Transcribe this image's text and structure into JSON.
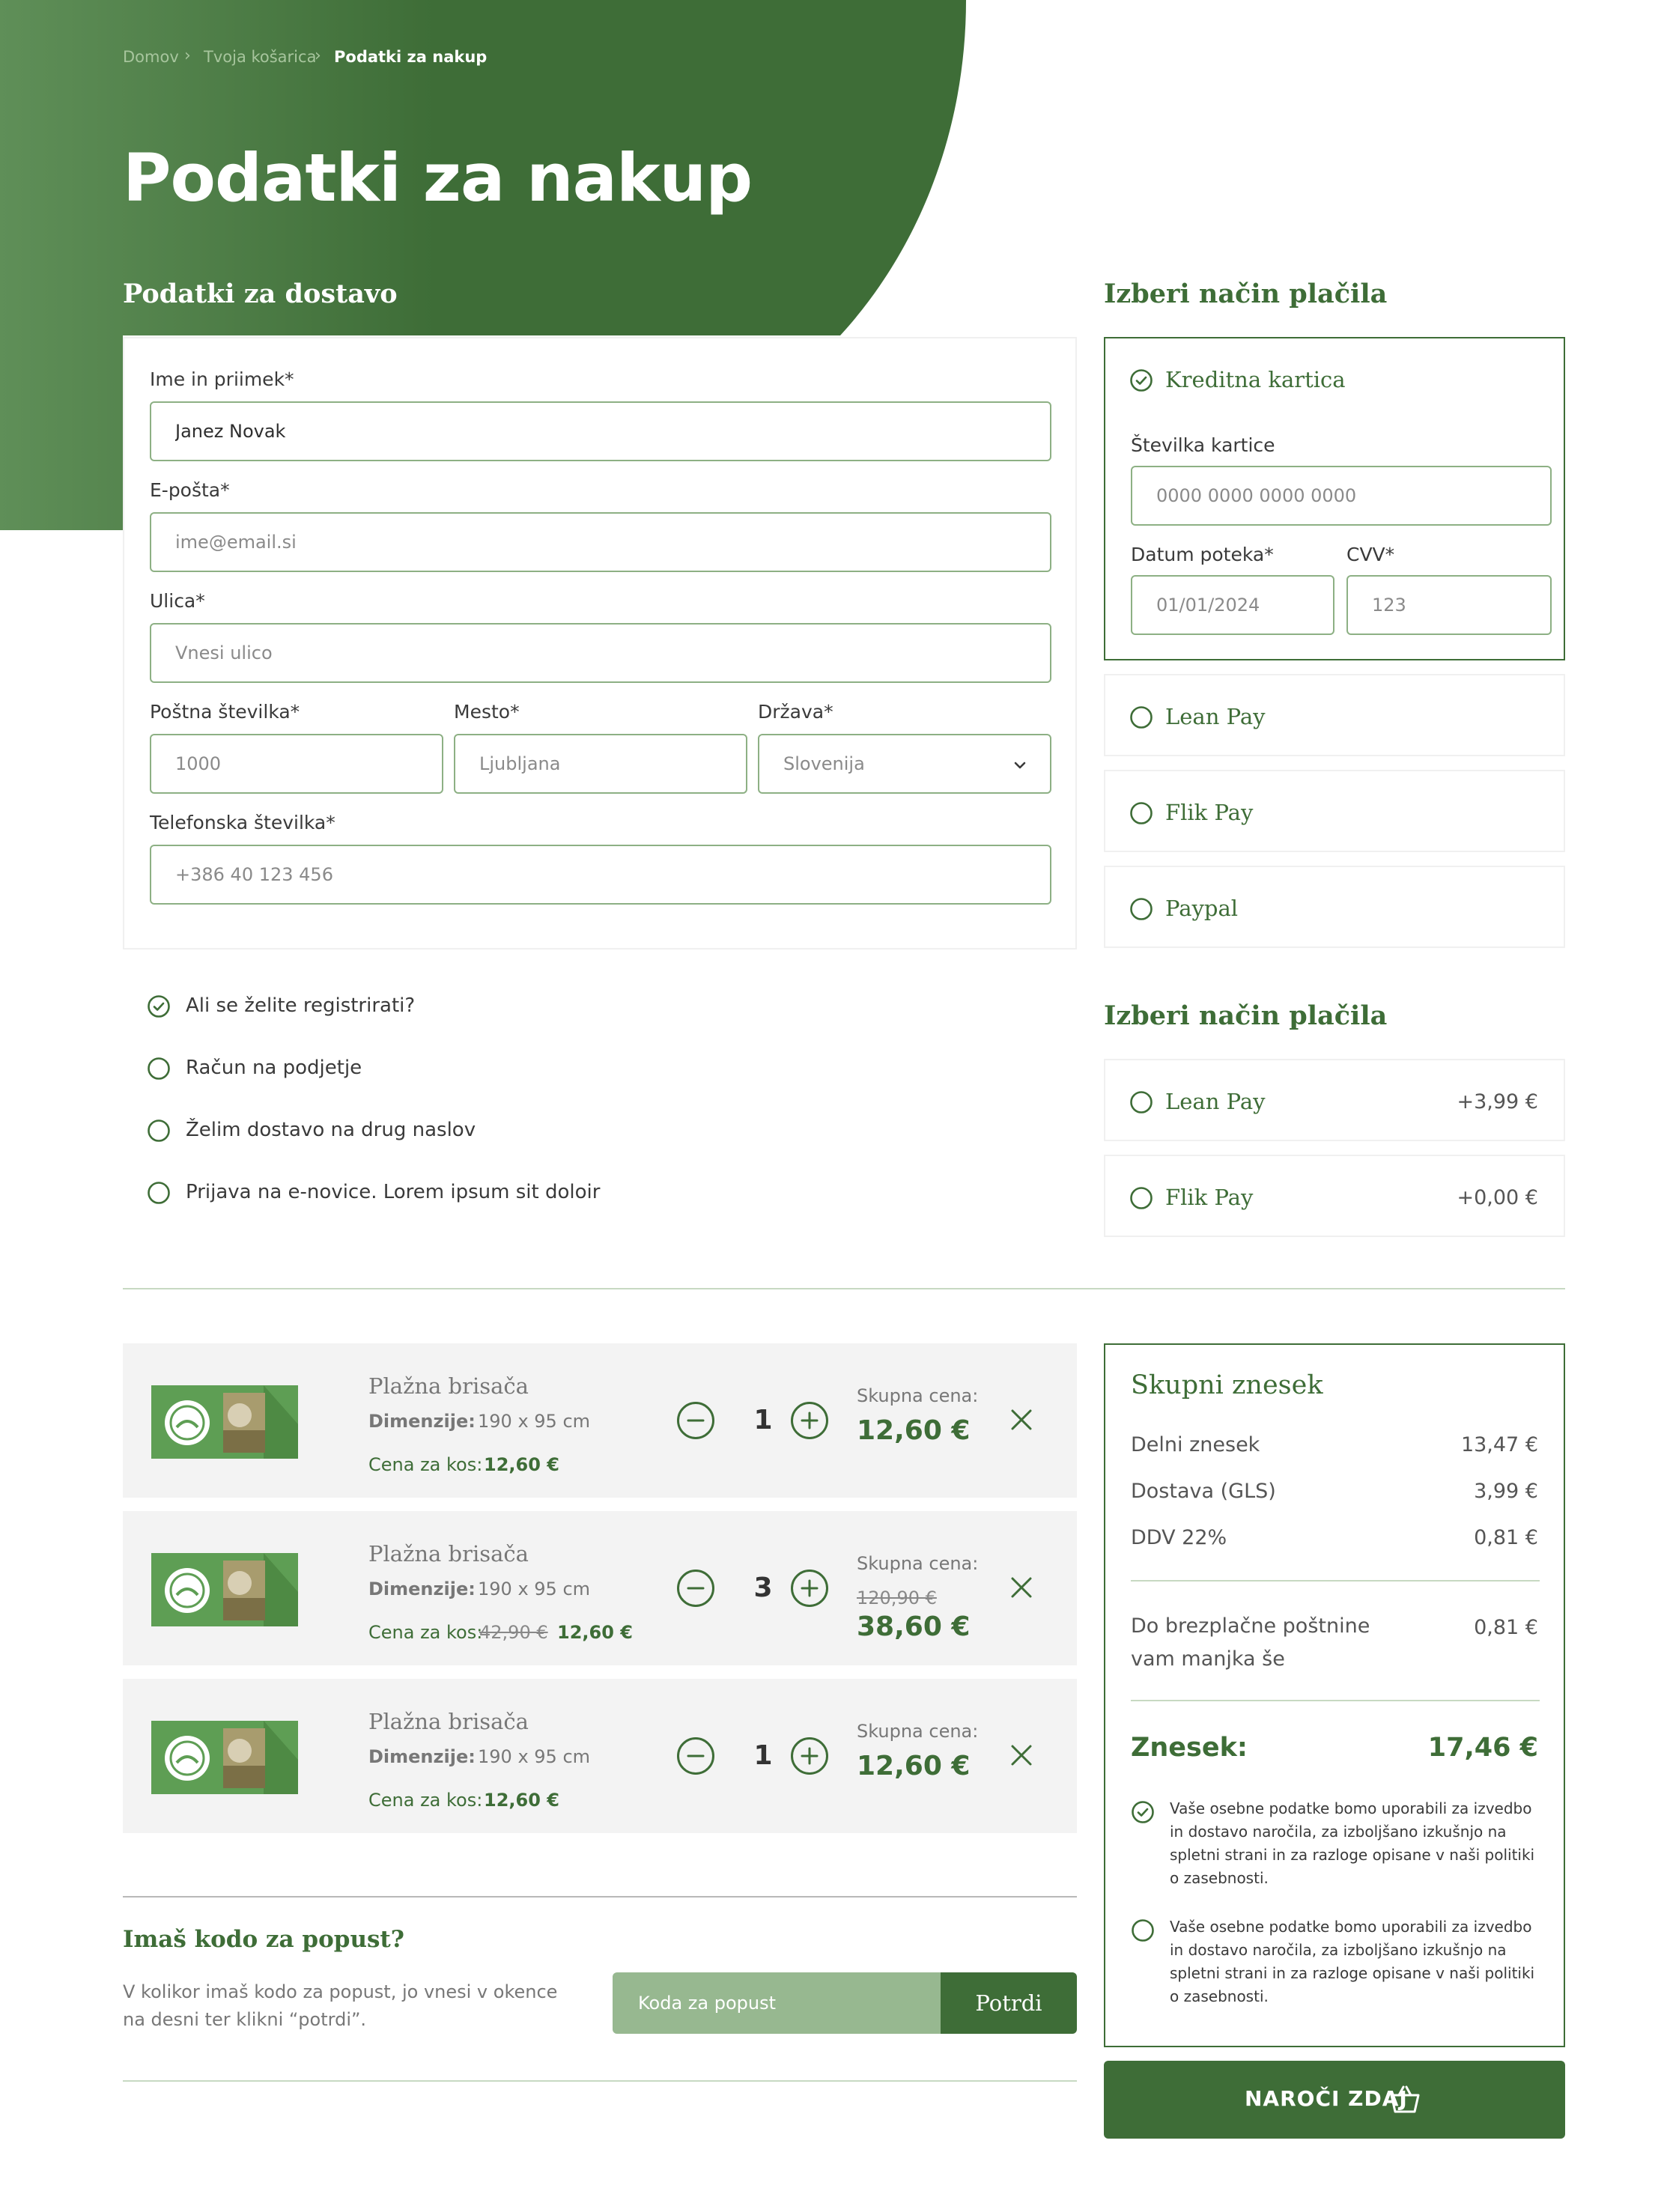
{
  "breadcrumb": {
    "home": "Domov",
    "cart": "Tvoja košarica",
    "current": "Podatki za nakup"
  },
  "page_title": "Podatki za nakup",
  "shipping": {
    "title": "Podatki za dostavo",
    "name_label": "Ime in priimek*",
    "name_value": "Janez Novak",
    "email_label": "E-pošta*",
    "email_placeholder": "ime@email.si",
    "street_label": "Ulica*",
    "street_placeholder": "Vnesi ulico",
    "zip_label": "Poštna številka*",
    "zip_placeholder": "1000",
    "city_label": "Mesto*",
    "city_placeholder": "Ljubljana",
    "country_label": "Država*",
    "country_value": "Slovenija",
    "phone_label": "Telefonska številka*",
    "phone_placeholder": "+386 40 123 456"
  },
  "options": [
    {
      "label": "Ali se želite registrirati?",
      "checked": true
    },
    {
      "label": "Račun na podjetje",
      "checked": false
    },
    {
      "label": "Želim dostavo na drug naslov",
      "checked": false
    },
    {
      "label": "Prijava na e-novice. Lorem ipsum sit doloir",
      "checked": false
    }
  ],
  "payment": {
    "title": "Izberi način plačila",
    "card_label": "Kreditna kartica",
    "card_number_label": "Številka kartice",
    "card_number_placeholder": "0000 0000 0000 0000",
    "expiry_label": "Datum poteka*",
    "expiry_placeholder": "01/01/2024",
    "cvv_label": "CVV*",
    "cvv_placeholder": "123",
    "methods": [
      "Lean Pay",
      "Flik Pay",
      "Paypal"
    ]
  },
  "delivery": {
    "title": "Izberi način plačila",
    "methods": [
      {
        "name": "Lean Pay",
        "price": "+3,99 €"
      },
      {
        "name": "Flik Pay",
        "price": "+0,00 €"
      }
    ]
  },
  "cart": {
    "items": [
      {
        "name": "Plažna brisača",
        "dim_label": "Dimenzije:",
        "dim_value": "190 x 95 cm",
        "unit_label": "Cena za kos:",
        "unit_old": "",
        "unit_price": "12,60 €",
        "qty": "1",
        "total_label": "Skupna cena:",
        "total_old": "",
        "total": "12,60 €"
      },
      {
        "name": "Plažna brisača",
        "dim_label": "Dimenzije:",
        "dim_value": "190 x 95 cm",
        "unit_label": "Cena za kos:",
        "unit_old": "42,90 €",
        "unit_price": "12,60 €",
        "qty": "3",
        "total_label": "Skupna cena:",
        "total_old": "120,90 €",
        "total": "38,60 €"
      },
      {
        "name": "Plažna brisača",
        "dim_label": "Dimenzije:",
        "dim_value": "190 x 95 cm",
        "unit_label": "Cena za kos:",
        "unit_old": "",
        "unit_price": "12,60 €",
        "qty": "1",
        "total_label": "Skupna cena:",
        "total_old": "",
        "total": "12,60 €"
      }
    ]
  },
  "discount": {
    "title": "Imaš kodo za popust?",
    "description": "V kolikor imaš kodo za popust, jo vnesi v okence na desni ter klikni  “potrdi”.",
    "placeholder": "Koda za popust",
    "button": "Potrdi"
  },
  "summary": {
    "title": "Skupni znesek",
    "subtotal_label": "Delni znesek",
    "subtotal": "13,47 €",
    "shipping_label": "Dostava (GLS)",
    "shipping": "3,99 €",
    "vat_label": "DDV 22%",
    "vat": "0,81 €",
    "free_shipping_line1": "Do brezplačne poštnine",
    "free_shipping_line2": "vam manjka še",
    "free_shipping": "0,81 €",
    "total_label": "Znesek:",
    "total": "17,46 €",
    "consents": [
      {
        "text": "Vaše osebne podatke bomo uporabili za izvedbo in dostavo naročila, za izboljšano izkušnjo na spletni strani in za razloge opisane v naši politiki o zasebnosti.",
        "checked": true
      },
      {
        "text": "Vaše osebne podatke bomo uporabili za izvedbo in dostavo naročila, za izboljšano izkušnjo na spletni strani in za razloge opisane v naši politiki o zasebnosti.",
        "checked": false
      }
    ]
  },
  "order_button": "NAROČI ZDAJ",
  "colors": {
    "primary": "#3e6d37",
    "hero_light": "#5f8f58",
    "field_border": "#8db084",
    "discount_input": "#97b890",
    "cart_bg": "#f3f3f3"
  }
}
